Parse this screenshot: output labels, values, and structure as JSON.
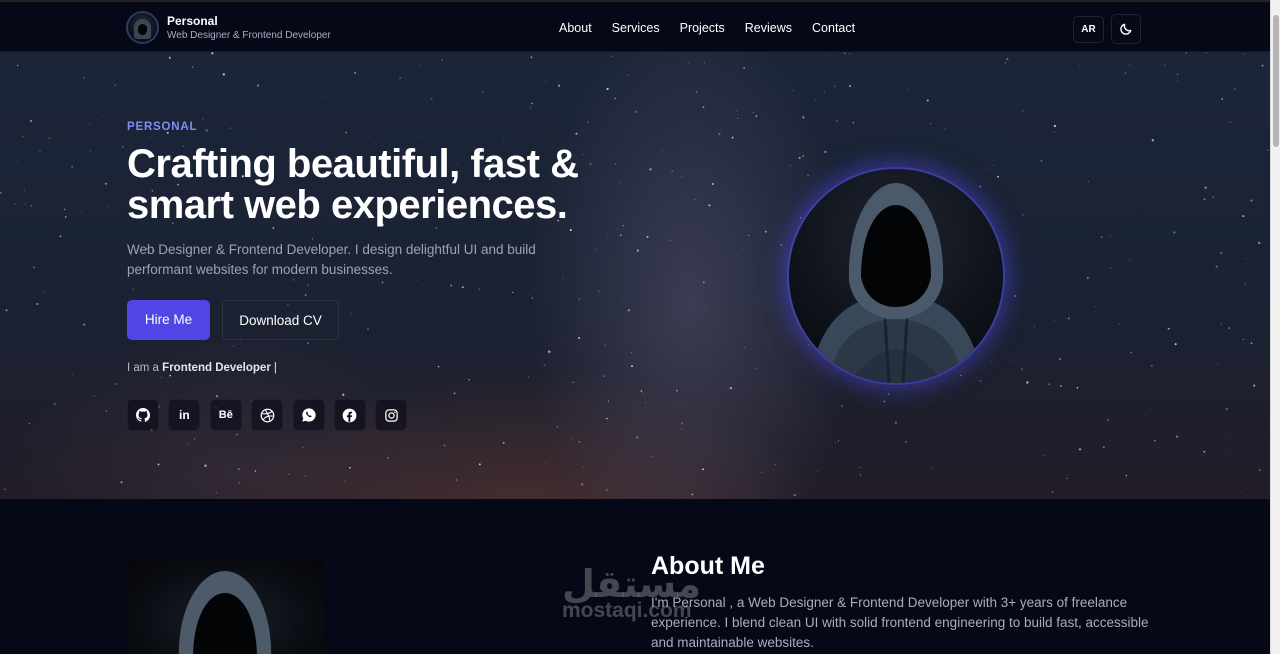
{
  "header": {
    "brand_name": "Personal",
    "brand_sub": "Web Designer & Frontend Developer",
    "nav": [
      "About",
      "Services",
      "Projects",
      "Reviews",
      "Contact"
    ],
    "lang_label": "AR",
    "theme_icon": "moon-icon"
  },
  "hero": {
    "eyebrow": "PERSONAL",
    "headline": "Crafting beautiful, fast & smart web experiences.",
    "lead": "Web Designer & Frontend Developer. I design delightful UI and build performant websites for modern businesses.",
    "hire_label": "Hire Me",
    "cv_label": "Download CV",
    "typing_prefix": "I am a",
    "typing_role": "Frontend Developer",
    "typing_caret": "|",
    "socials": [
      {
        "name": "github-icon"
      },
      {
        "name": "linkedin-icon",
        "glyph": "in"
      },
      {
        "name": "behance-icon",
        "glyph": "Bē"
      },
      {
        "name": "dribbble-icon"
      },
      {
        "name": "whatsapp-icon"
      },
      {
        "name": "facebook-icon"
      },
      {
        "name": "instagram-icon"
      }
    ]
  },
  "about": {
    "title": "About Me",
    "text": "I'm Personal , a Web Designer & Frontend Developer with 3+ years of freelance experience. I blend clean UI with solid frontend engineering to build fast, accessible and maintainable websites."
  },
  "watermark": {
    "arabic": "مستقل",
    "latin": "mostaqi.com"
  },
  "colors": {
    "accent": "#4f46e5",
    "eyebrow": "#818cf8",
    "background": "#050816"
  }
}
